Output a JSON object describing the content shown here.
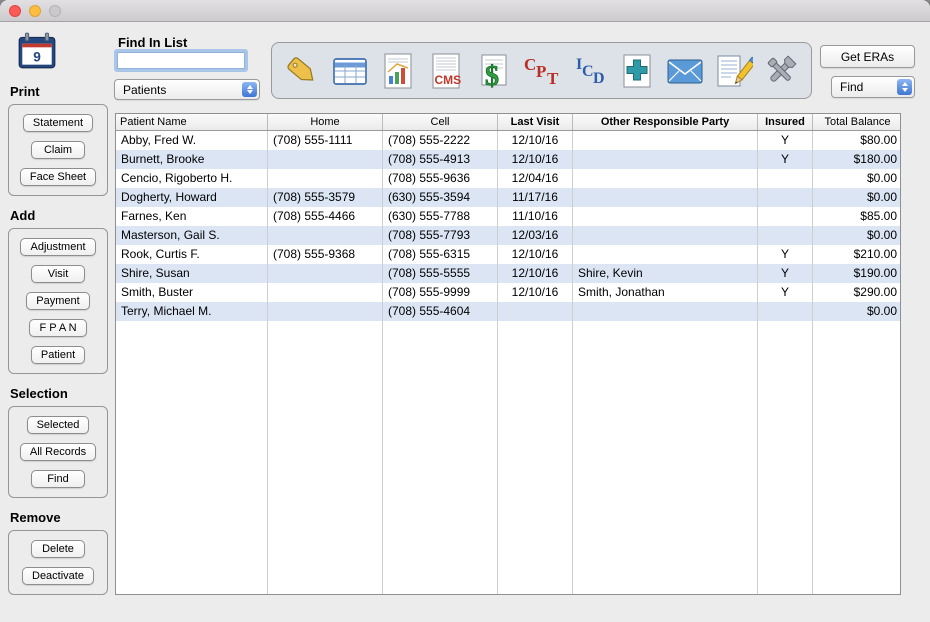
{
  "sidebar": {
    "calendar_day": "9",
    "sections": [
      {
        "label": "Print",
        "buttons": [
          "Statement",
          "Claim",
          "Face Sheet"
        ]
      },
      {
        "label": "Add",
        "buttons": [
          "Adjustment",
          "Visit",
          "Payment",
          "F P A N",
          "Patient"
        ]
      },
      {
        "label": "Selection",
        "buttons": [
          "Selected",
          "All Records",
          "Find"
        ]
      },
      {
        "label": "Remove",
        "buttons": [
          "Delete",
          "Deactivate"
        ]
      }
    ]
  },
  "topbar": {
    "find_in_list_label": "Find In List",
    "find_input_value": "",
    "list_select_value": "Patients",
    "get_eras_label": "Get ERAs",
    "find_select_value": "Find",
    "toolbar_icons": [
      "tag-ledger",
      "spreadsheet",
      "report-chart",
      "cms-claim-form",
      "charges-dollar",
      "cpt-codes",
      "icd-codes",
      "medical-cross",
      "email-envelope",
      "notes-pencil",
      "tools-preferences"
    ]
  },
  "table": {
    "columns": [
      "Patient Name",
      "Home",
      "Cell",
      "Last Visit",
      "Other Responsible Party",
      "Insured",
      "Total Balance"
    ],
    "rows": [
      [
        "Abby, Fred W.",
        "(708) 555-1111",
        "(708) 555-2222",
        "12/10/16",
        "",
        "Y",
        "$80.00"
      ],
      [
        "Burnett, Brooke",
        "",
        "(708) 555-4913",
        "12/10/16",
        "",
        "Y",
        "$180.00"
      ],
      [
        "Cencio, Rigoberto H.",
        "",
        "(708) 555-9636",
        "12/04/16",
        "",
        "",
        "$0.00"
      ],
      [
        "Dogherty, Howard",
        "(708) 555-3579",
        "(630) 555-3594",
        "11/17/16",
        "",
        "",
        "$0.00"
      ],
      [
        "Farnes, Ken",
        "(708) 555-4466",
        "(630) 555-7788",
        "11/10/16",
        "",
        "",
        "$85.00"
      ],
      [
        "Masterson, Gail S.",
        "",
        "(708) 555-7793",
        "12/03/16",
        "",
        "",
        "$0.00"
      ],
      [
        "Rook, Curtis F.",
        "(708) 555-9368",
        "(708) 555-6315",
        "12/10/16",
        "",
        "Y",
        "$210.00"
      ],
      [
        "Shire, Susan",
        "",
        "(708) 555-5555",
        "12/10/16",
        "Shire, Kevin",
        "Y",
        "$190.00"
      ],
      [
        "Smith, Buster",
        "",
        "(708) 555-9999",
        "12/10/16",
        "Smith, Jonathan",
        "Y",
        "$290.00"
      ],
      [
        "Terry, Michael M.",
        "",
        "(708) 555-4604",
        "",
        "",
        "",
        "$0.00"
      ]
    ]
  },
  "colors": {
    "row_stripe": "#dbe5f4",
    "accent_blue": "#3f76d3",
    "toolbar_bg": "#dde2e9"
  }
}
